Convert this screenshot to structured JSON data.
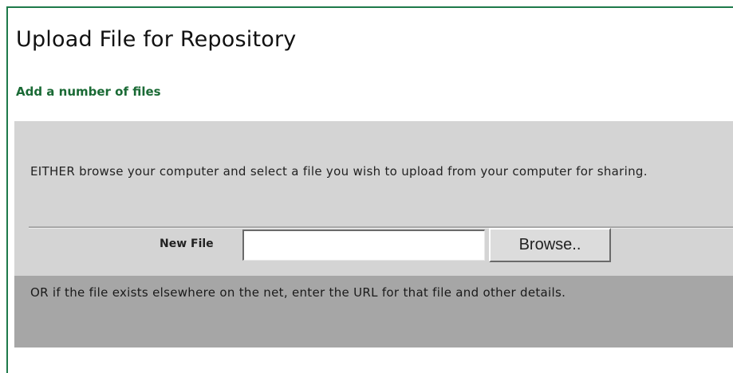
{
  "page": {
    "title": "Upload File for Repository",
    "subtitle": "Add a number of files"
  },
  "browse_section": {
    "instructions": "EITHER browse your computer and select a file you wish to upload from your computer for sharing.",
    "new_file_label": "New File",
    "new_file_value": "",
    "browse_button_label": "Browse.."
  },
  "url_section": {
    "instructions": "OR if the file exists elsewhere on the net, enter the URL for that file and other details."
  },
  "colors": {
    "accent_green": "#1a6a35",
    "frame_border": "#1e7a4a",
    "panel_light": "#d4d4d4",
    "panel_dark": "#a6a6a6"
  }
}
